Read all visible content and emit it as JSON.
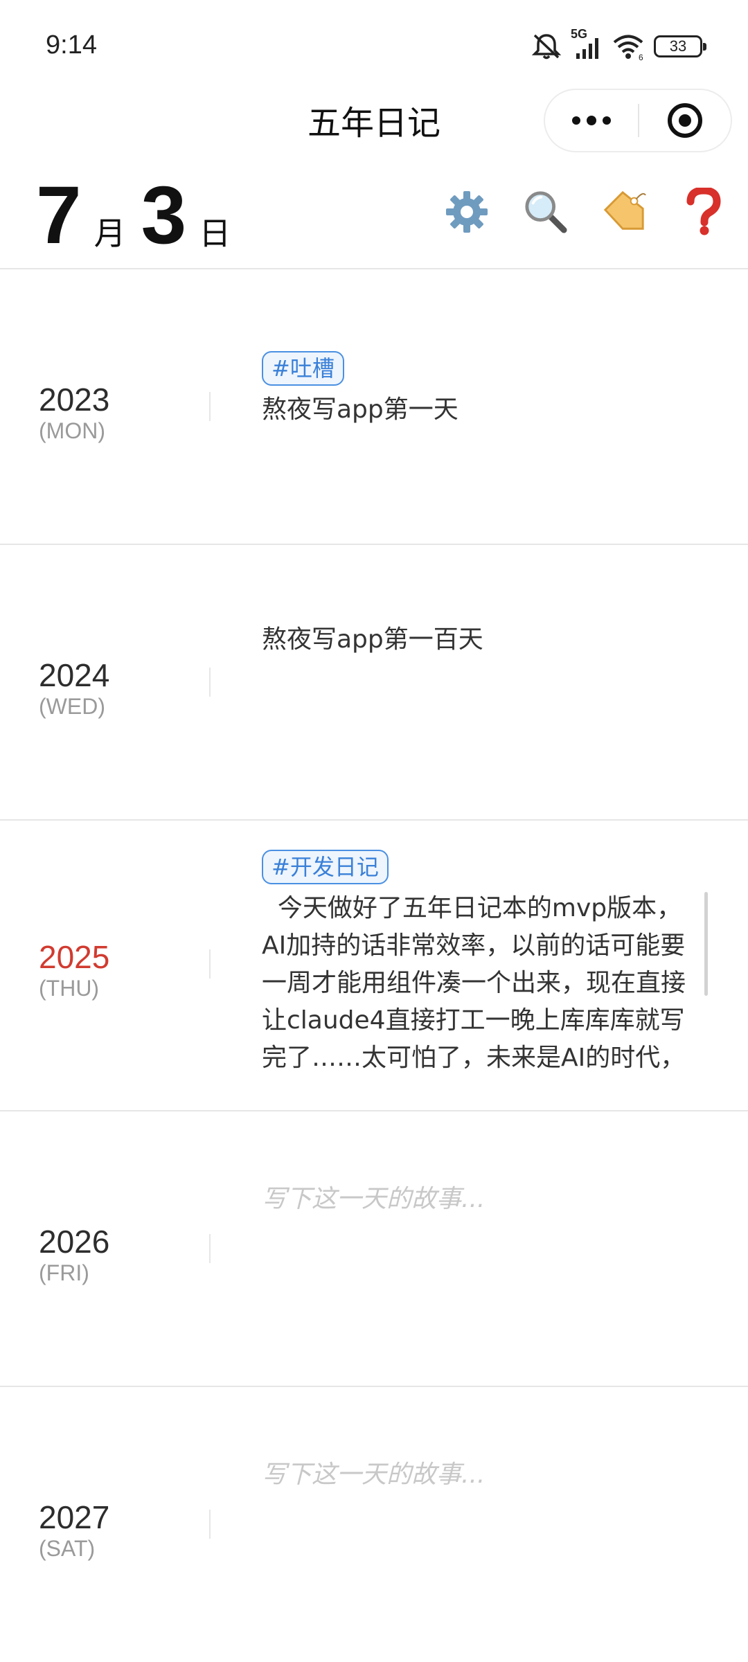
{
  "status_bar": {
    "time": "9:14",
    "network": "5G",
    "battery": "33",
    "icons": [
      "mute-icon",
      "signal-icon",
      "wifi-icon",
      "battery-icon"
    ]
  },
  "nav": {
    "title": "五年日记"
  },
  "date_header": {
    "month": "7",
    "month_unit": "月",
    "day": "3",
    "day_unit": "日"
  },
  "toolbar": {
    "icons": [
      "gear-icon",
      "search-icon",
      "tag-icon",
      "help-icon"
    ]
  },
  "entries": [
    {
      "year": "2023",
      "weekday": "(MON)",
      "tag": "#吐槽",
      "text": "熬夜写app第一天"
    },
    {
      "year": "2024",
      "weekday": "(WED)",
      "text": "熬夜写app第一百天"
    },
    {
      "year": "2025",
      "weekday": "(THU)",
      "tag": "#开发日记",
      "text": "  今天做好了五年日记本的mvp版本，AI加持的话非常效率，以前的话可能要一周才能用组件凑一个出来，现在直接让claude4直接打工一晚上库库库就写完了……太可怕了，未来是AI的时代，已全油程序员的工作被"
    },
    {
      "year": "2026",
      "weekday": "(FRI)",
      "placeholder": "写下这一天的故事..."
    },
    {
      "year": "2027",
      "weekday": "(SAT)",
      "placeholder": "写下这一天的故事..."
    }
  ],
  "colors": {
    "current_year": "#d13b30",
    "tag_border": "#4a90e2",
    "placeholder": "#c8c8c8"
  }
}
